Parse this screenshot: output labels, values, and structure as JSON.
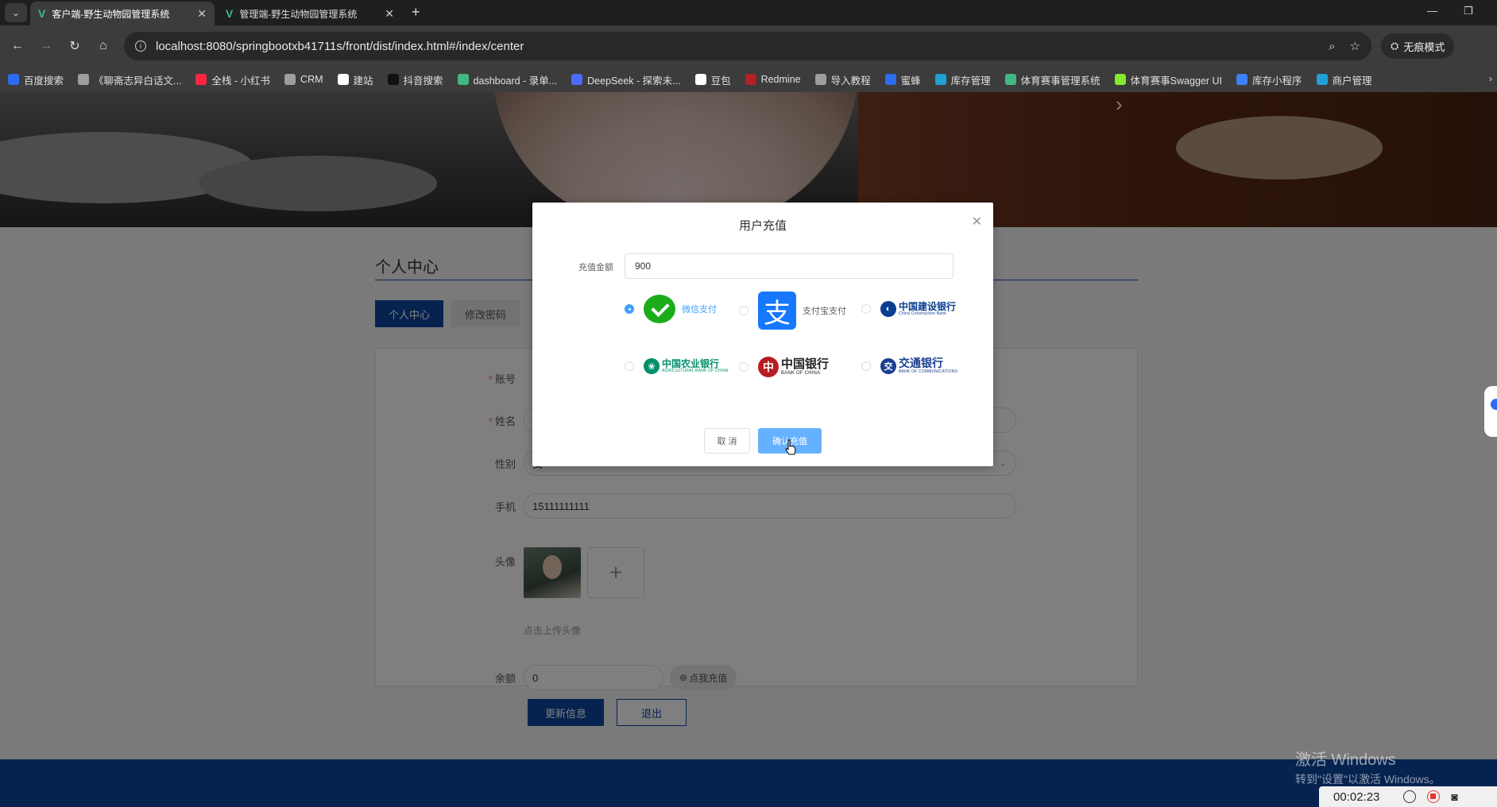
{
  "browser": {
    "tabs": [
      {
        "title": "客户端-野生动物园管理系统",
        "active": true
      },
      {
        "title": "管理端-野生动物园管理系统",
        "active": false
      }
    ],
    "url": "localhost:8080/springbootxb41711s/front/dist/index.html#/index/center",
    "incognito_label": "无痕模式",
    "bookmarks": [
      {
        "label": "百度搜索",
        "color": "#2f6bf1"
      },
      {
        "label": "《聊斋志异白话文...",
        "color": "#9e9e9e"
      },
      {
        "label": "全栈 - 小红书",
        "color": "#ff2442"
      },
      {
        "label": "CRM",
        "color": "#9e9e9e"
      },
      {
        "label": "建站",
        "color": "#ffffff"
      },
      {
        "label": "抖音搜索",
        "color": "#111111"
      },
      {
        "label": "dashboard - 录单...",
        "color": "#41b883"
      },
      {
        "label": "DeepSeek - 探索未...",
        "color": "#4d6bfe"
      },
      {
        "label": "豆包",
        "color": "#ffffff"
      },
      {
        "label": "Redmine",
        "color": "#b32024"
      },
      {
        "label": "导入教程",
        "color": "#9e9e9e"
      },
      {
        "label": "蜜蜂",
        "color": "#2f6bf1"
      },
      {
        "label": "库存管理",
        "color": "#1fa1d3"
      },
      {
        "label": "体育赛事管理系统",
        "color": "#41b883"
      },
      {
        "label": "体育赛事Swagger UI",
        "color": "#85ea2d"
      },
      {
        "label": "库存小程序",
        "color": "#3b82f6"
      },
      {
        "label": "商户管理",
        "color": "#1fa1d3"
      }
    ]
  },
  "page": {
    "section_title": "个人中心",
    "tabs": [
      {
        "label": "个人中心",
        "active": true
      },
      {
        "label": "修改密码",
        "active": false
      }
    ],
    "form": {
      "account_label": "账号",
      "name_label": "姓名",
      "gender_label": "性别",
      "gender_value": "女",
      "phone_label": "手机",
      "phone_value": "15111111111",
      "avatar_label": "头像",
      "upload_hint": "点击上传头像",
      "balance_label": "余额",
      "balance_value": "0",
      "recharge_label": "点我充值",
      "update_label": "更新信息",
      "logout_label": "退出"
    }
  },
  "dialog": {
    "title": "用户充值",
    "amount_label": "充值金额",
    "amount_value": "900",
    "payment_options": [
      {
        "id": "wechat",
        "label": "微信支付",
        "checked": true
      },
      {
        "id": "alipay",
        "label": "支付宝支付",
        "checked": false
      },
      {
        "id": "ccb",
        "bank_cn": "中国建设银行",
        "bank_en": "China Construction Bank",
        "color": "#0a3d91",
        "checked": false
      },
      {
        "id": "abc",
        "bank_cn": "中国农业银行",
        "bank_en": "AGRICULTURAL BANK OF CHINA",
        "color": "#008f6b",
        "checked": false
      },
      {
        "id": "boc",
        "bank_cn": "中国银行",
        "bank_en": "BANK OF CHINA",
        "color": "#b81c22",
        "checked": false
      },
      {
        "id": "bocom",
        "bank_cn": "交通银行",
        "bank_en": "BANK OF COMMUNICATIONS",
        "color": "#1b3f8f",
        "checked": false
      }
    ],
    "cancel_label": "取 消",
    "confirm_label": "确认充值"
  },
  "system": {
    "watermark_line1": "激活 Windows",
    "watermark_line2": "转到\"设置\"以激活 Windows。",
    "recorder_time": "00:02:23"
  }
}
